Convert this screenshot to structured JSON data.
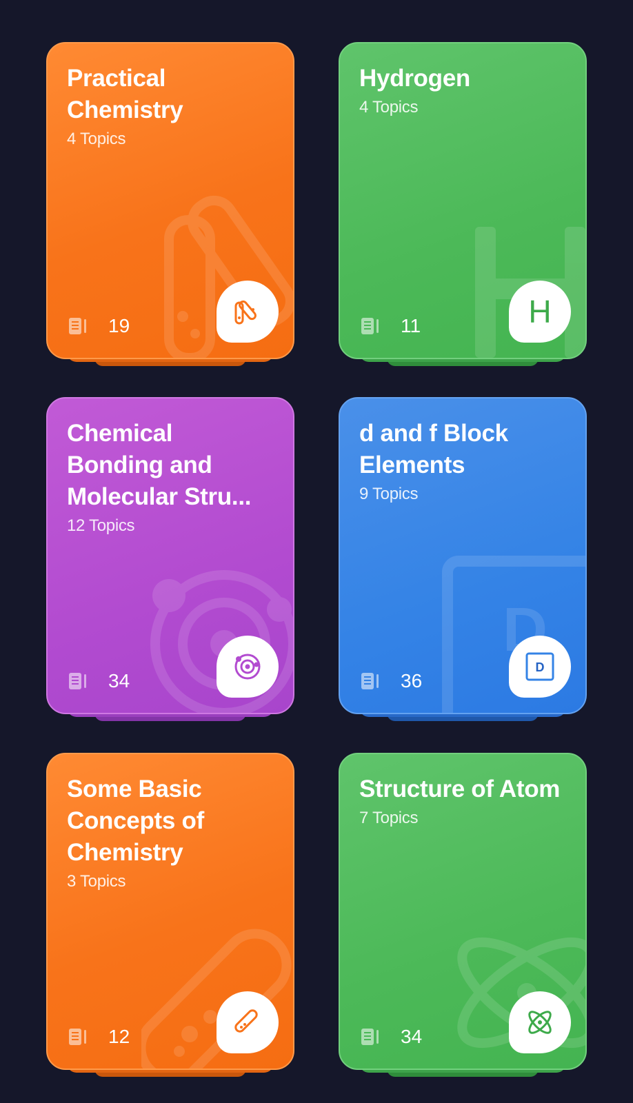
{
  "cards": [
    {
      "title": "Practical Chemistry",
      "topics": "4 Topics",
      "count": "19",
      "color": "#f8731a",
      "icon": "test-tubes-icon"
    },
    {
      "title": "Hydrogen",
      "topics": "4 Topics",
      "count": "11",
      "color": "#4cb958",
      "icon": "hydrogen-letter-icon",
      "badge_text": "H"
    },
    {
      "title": "Chemical Bonding and Molecular Stru...",
      "topics": "12 Topics",
      "count": "34",
      "color": "#b24bd0",
      "icon": "orbit-icon"
    },
    {
      "title": "d and f Block Elements",
      "topics": "9 Topics",
      "count": "36",
      "color": "#3483e6",
      "icon": "element-block-icon",
      "badge_text": "D"
    },
    {
      "title": "Some Basic Concepts of Chemistry",
      "topics": "3 Topics",
      "count": "12",
      "color": "#f8731a",
      "icon": "test-tube-icon"
    },
    {
      "title": "Structure of Atom",
      "topics": "7 Topics",
      "count": "34",
      "color": "#4cb958",
      "icon": "atom-icon"
    }
  ],
  "colors": {
    "background": "#15172a",
    "orange": "#f8731a",
    "green": "#4cb958",
    "purple": "#b24bd0",
    "blue": "#3483e6"
  }
}
